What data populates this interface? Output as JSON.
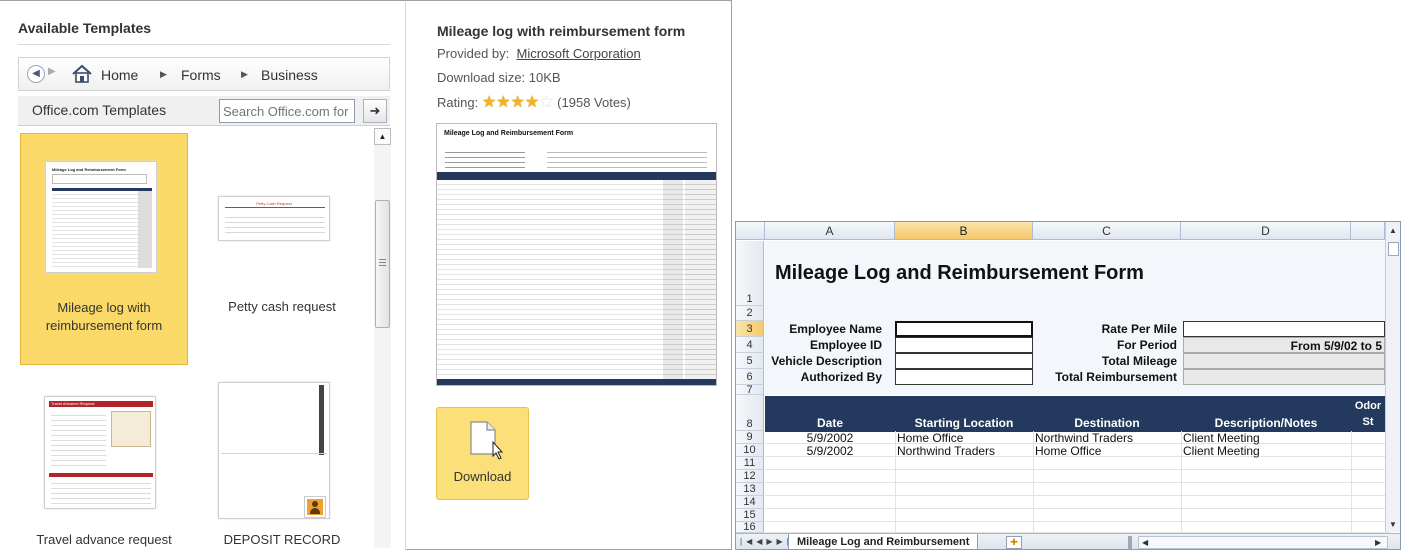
{
  "left_panel": {
    "title": "Available Templates",
    "nav": {
      "back_glyph": "◀",
      "forward_glyph": "▶",
      "crumbs": [
        "Home",
        "Forms",
        "Business"
      ]
    },
    "office_title": "Office.com Templates",
    "search_placeholder": "Search Office.com for",
    "templates": [
      {
        "label": "Mileage log with reimbursement form",
        "selected": true
      },
      {
        "label": "Petty cash request",
        "selected": false
      },
      {
        "label": "Travel advance request",
        "selected": false
      },
      {
        "label": "DEPOSIT RECORD",
        "selected": false
      }
    ],
    "thumb_text": {
      "mileage": "Mileage Log and Reimbursement Form",
      "petty": "Petty Cash Request",
      "travel": "Travel Advance Request"
    }
  },
  "details": {
    "title": "Mileage log with reimbursement form",
    "provided_label": "Provided by:",
    "provider": "Microsoft Corporation",
    "download_size": "Download size: 10KB",
    "rating_label": "Rating:",
    "rating": 4,
    "rating_max": 5,
    "votes": "(1958 Votes)",
    "preview_title": "Mileage Log and Reimbursement Form",
    "download_label": "Download"
  },
  "sheet": {
    "columns": [
      "A",
      "B",
      "C",
      "D"
    ],
    "selected_column": "B",
    "title": "Mileage Log and Reimbursement Form",
    "rows": [
      "1",
      "2",
      "3",
      "4",
      "5",
      "6",
      "7",
      "8",
      "9",
      "10",
      "11",
      "12",
      "13",
      "14",
      "15",
      "16"
    ],
    "selected_row": "3",
    "left_labels": [
      "Employee Name",
      "Employee ID",
      "Vehicle Description",
      "Authorized By"
    ],
    "right_labels": [
      "Rate Per Mile",
      "For Period",
      "Total Mileage",
      "Total Reimbursement"
    ],
    "period_value": "From 5/9/02 to 5",
    "headers": [
      "Date",
      "Starting Location",
      "Destination",
      "Description/Notes"
    ],
    "odo_header": "Odor St",
    "data_rows": [
      {
        "date": "5/9/2002",
        "start": "Home Office",
        "dest": "Northwind Traders",
        "notes": "Client Meeting"
      },
      {
        "date": "5/9/2002",
        "start": "Northwind Traders",
        "dest": "Home Office",
        "notes": "Client Meeting"
      }
    ],
    "tab_label": "Mileage Log and Reimbursement"
  },
  "colors": {
    "selected_tile": "#fad969",
    "header_navy": "#233a5e",
    "star": "#f1b51f"
  }
}
